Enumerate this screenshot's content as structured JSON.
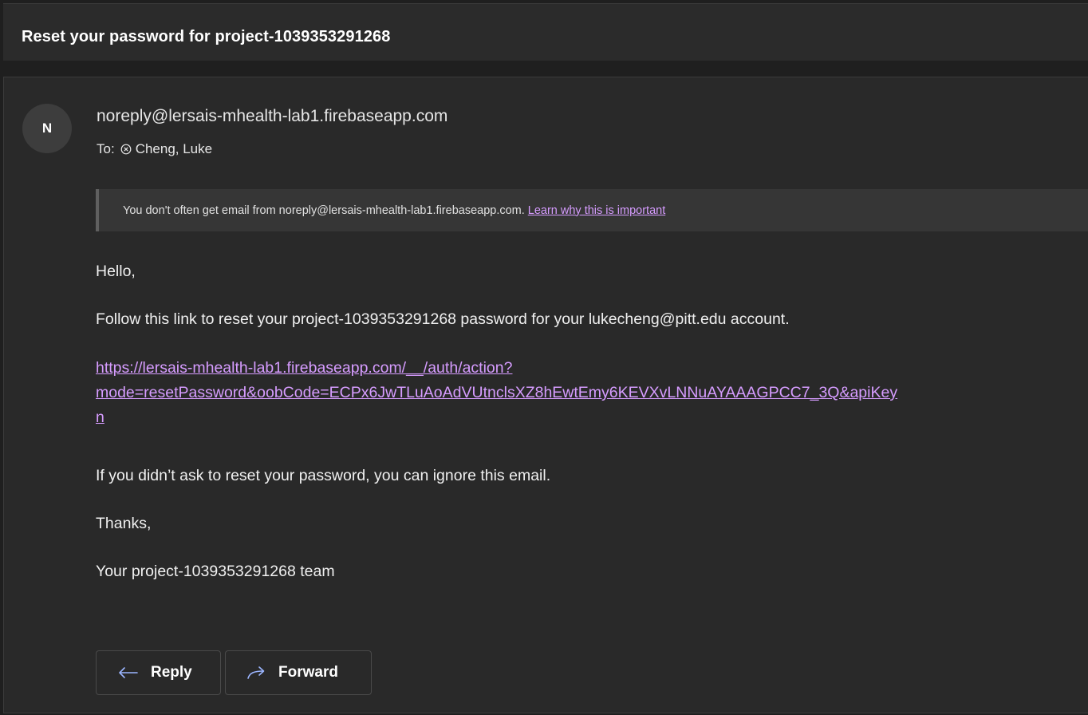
{
  "subject": "Reset your password for project-1039353291268",
  "sender": {
    "avatar_initial": "N",
    "email": "noreply@lersais-mhealth-lab1.firebaseapp.com"
  },
  "recipients": {
    "label": "To:",
    "name": "Cheng, Luke",
    "icon": "remove-recipient-icon"
  },
  "banner": {
    "text": "You don't often get email from noreply@lersais-mhealth-lab1.firebaseapp.com.",
    "link": "Learn why this is important"
  },
  "body": {
    "greeting": "Hello,",
    "instruction": "Follow this link to reset your project-1039353291268 password for your lukecheng@pitt.edu account.",
    "link_line1": "https://lersais-mhealth-lab1.firebaseapp.com/__/auth/action?",
    "link_line2": "mode=resetPassword&oobCode=ECPx6JwTLuAoAdVUtnclsXZ8hEwtEmy6KEVXvLNNuAYAAAGPCC7_3Q&apiKey",
    "link_line3": "n",
    "ignore": "If you didn’t ask to reset your password, you can ignore this email.",
    "thanks": "Thanks,",
    "signoff": "Your project-1039353291268 team"
  },
  "actions": {
    "reply": "Reply",
    "forward": "Forward"
  },
  "colors": {
    "background": "#1f1f1f",
    "pane": "#292929",
    "link": "#d69cff"
  }
}
